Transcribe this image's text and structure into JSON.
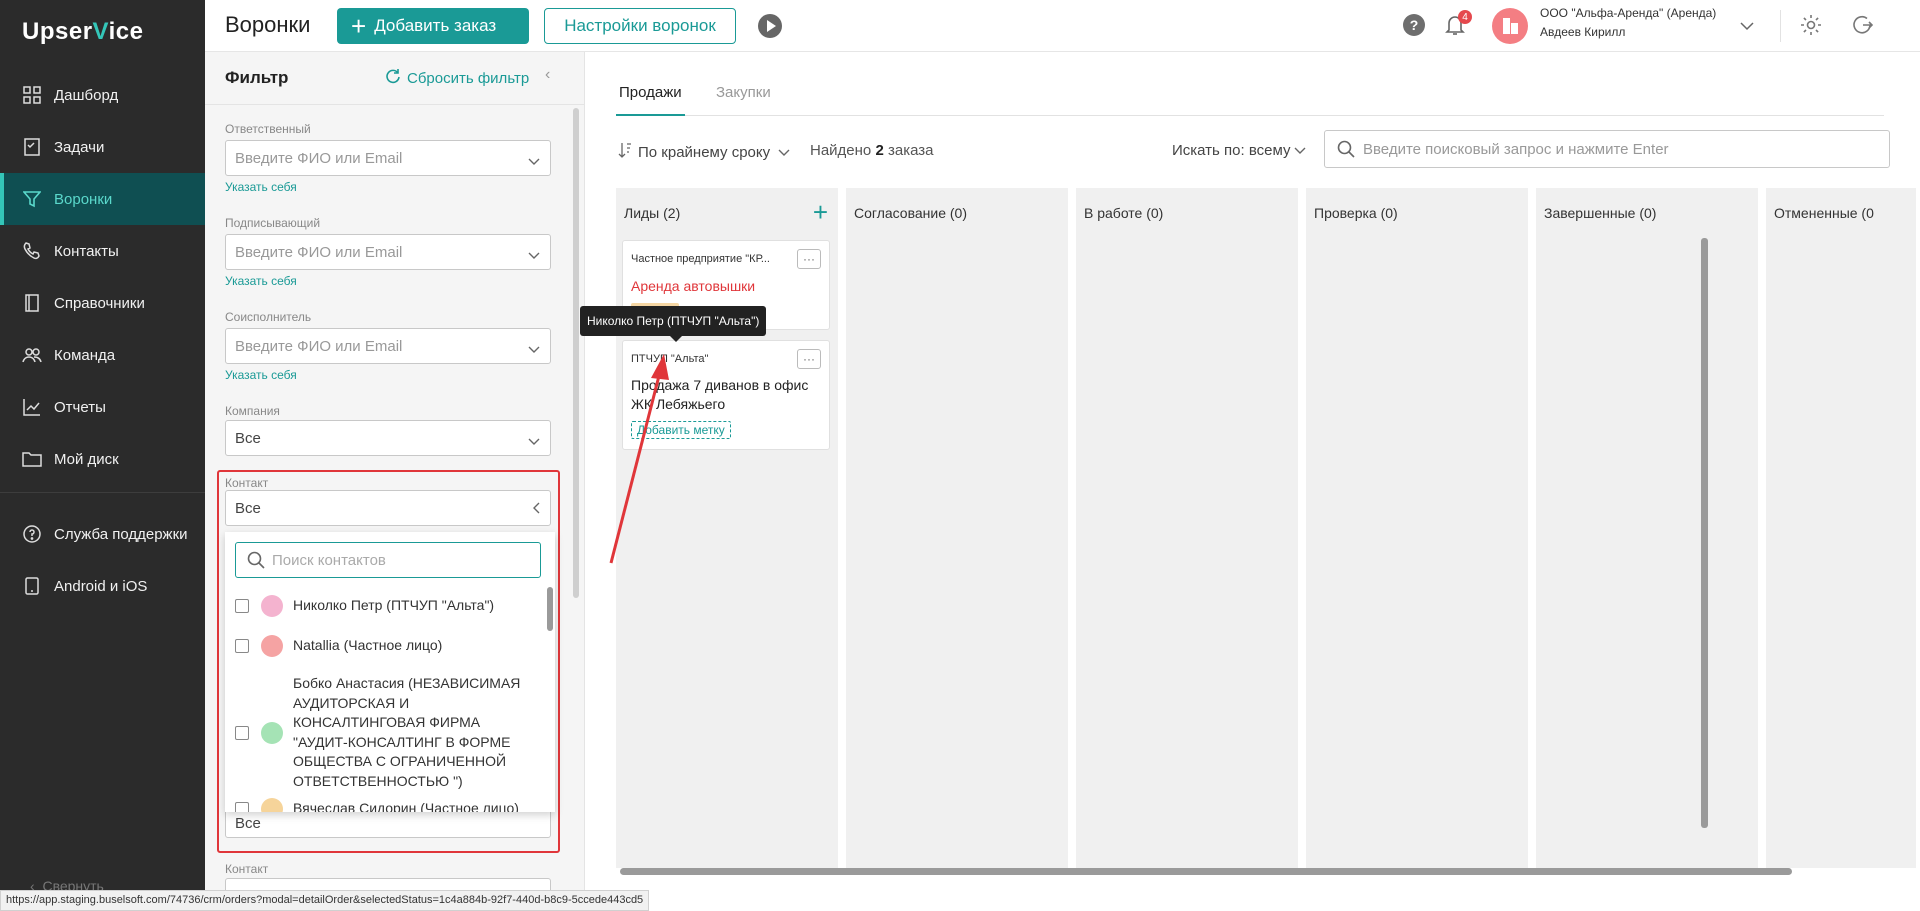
{
  "app": {
    "logo_left": "Upser",
    "logo_accent": "V",
    "logo_right": "ice"
  },
  "sidebar": {
    "items": [
      {
        "label": "Дашборд",
        "icon": "dashboard-icon"
      },
      {
        "label": "Задачи",
        "icon": "tasks-icon"
      },
      {
        "label": "Воронки",
        "icon": "funnel-icon",
        "active": true
      },
      {
        "label": "Контакты",
        "icon": "phone-icon"
      },
      {
        "label": "Справочники",
        "icon": "book-icon"
      },
      {
        "label": "Команда",
        "icon": "team-icon"
      },
      {
        "label": "Отчеты",
        "icon": "chart-icon"
      },
      {
        "label": "Мой диск",
        "icon": "folder-icon"
      }
    ],
    "bottom_items": [
      {
        "label": "Служба поддержки",
        "icon": "help-circle-icon"
      },
      {
        "label": "Android и iOS",
        "icon": "mobile-icon"
      }
    ],
    "collapse_label": "Свернуть"
  },
  "header": {
    "title": "Воронки",
    "add_order": "Добавить заказ",
    "funnel_settings": "Настройки воронок",
    "notifications_count": "4",
    "company": "ООО \"Альфа-Аренда\" (Аренда)",
    "user": "Авдеев Кирилл"
  },
  "filter": {
    "title": "Фильтр",
    "reset": "Сбросить фильтр",
    "fields": {
      "responsible": {
        "label": "Ответственный",
        "placeholder": "Введите ФИО или Email",
        "link": "Указать себя"
      },
      "signer": {
        "label": "Подписывающий",
        "placeholder": "Введите ФИО или Email",
        "link": "Указать себя"
      },
      "coexecutor": {
        "label": "Соисполнитель",
        "placeholder": "Введите ФИО или Email",
        "link": "Указать себя"
      },
      "company": {
        "label": "Компания",
        "value": "Все"
      },
      "contact": {
        "label": "Контакт",
        "value": "Все"
      },
      "hidden_select_value": "Все",
      "contact2": {
        "label": "Контакт"
      }
    },
    "dropdown": {
      "search_placeholder": "Поиск контактов",
      "items": [
        {
          "text": "Николко Петр (ПТЧУП \"Альта\")",
          "avatar_color": "#f4b3cf"
        },
        {
          "text": "Natallia (Частное лицо)",
          "avatar_color": "#f5a3a3"
        },
        {
          "text": "Бобко Анастасия (НЕЗАВИСИМАЯ АУДИТОРСКАЯ И КОНСАЛТИНГОВАЯ ФИРМА \"АУДИТ-КОНСАЛТИНГ В ФОРМЕ ОБЩЕСТВА С ОГРАНИЧЕННОЙ ОТВЕТСТВЕННОСТЬЮ \")",
          "avatar_color": "#a5e3b5"
        },
        {
          "text": "Вячеслав Сидорин (Частное лицо)",
          "avatar_color": "#f6d49a"
        }
      ]
    }
  },
  "main": {
    "tabs": [
      {
        "label": "Продажи",
        "active": true
      },
      {
        "label": "Закупки",
        "active": false
      }
    ],
    "sort_label": "По крайнему сроку",
    "found_prefix": "Найдено",
    "found_count": "2",
    "found_suffix": "заказа",
    "search_by": "Искать по: всему",
    "search_placeholder": "Введите поисковый запрос и нажмите Enter",
    "columns": [
      {
        "title": "Лиды (2)"
      },
      {
        "title": "Согласование (0)"
      },
      {
        "title": "В работе (0)"
      },
      {
        "title": "Проверка (0)"
      },
      {
        "title": "Завершенные (0)"
      },
      {
        "title": "Отмененные (0"
      }
    ],
    "cards": [
      {
        "company": "Частное предприятие \"КР...",
        "title": "Аренда автовышки",
        "title_color": "#e0363a",
        "menu": "···"
      },
      {
        "company": "ПТЧУП \"Альта\"",
        "title": "Продажа 7 диванов в офис ЖК Лебяжьего",
        "title_color": "#222",
        "tag": "Добавить метку",
        "menu": "···"
      }
    ]
  },
  "tooltip": "Николко Петр (ПТЧУП \"Альта\")",
  "status_url": "https://app.staging.buselsoft.com/74736/crm/orders?modal=detailOrder&selectedStatus=1c4a884b-92f7-440d-b8c9-5ccede443cd5",
  "colors": {
    "accent": "#1a9a96",
    "sidebar_bg": "#2b2b2b",
    "annotation_red": "#e0363a"
  }
}
